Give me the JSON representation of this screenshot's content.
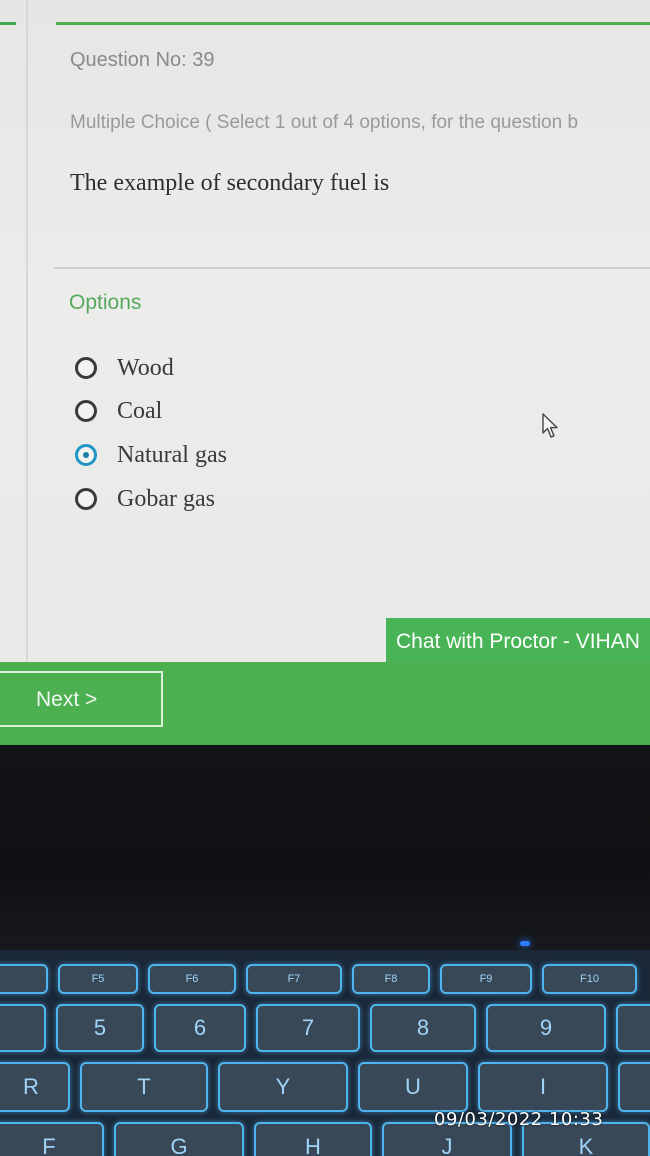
{
  "question": {
    "number_label": "Question No: 39",
    "type_label": "Multiple Choice ( Select 1 out of 4 options, for the question b",
    "text": "The example of secondary fuel is"
  },
  "options": {
    "title": "Options",
    "items": [
      {
        "label": "Wood",
        "selected": false
      },
      {
        "label": "Coal",
        "selected": false
      },
      {
        "label": "Natural gas",
        "selected": true
      },
      {
        "label": "Gobar gas",
        "selected": false
      }
    ]
  },
  "chat": {
    "label": "Chat with Proctor - VIHAN"
  },
  "nav": {
    "next_label": "Next >"
  },
  "colors": {
    "accent": "#4caf50",
    "selected_radio": "#2196c6"
  },
  "photo": {
    "timestamp": "09/03/2022 10:33"
  },
  "keyboard": {
    "keys": [
      "F5",
      "F6",
      "F7",
      "F8",
      "F9",
      "F10",
      "5",
      "6",
      "7",
      "8",
      "9",
      "R",
      "T",
      "Y",
      "U",
      "I",
      "F",
      "G",
      "H",
      "J",
      "K"
    ]
  }
}
